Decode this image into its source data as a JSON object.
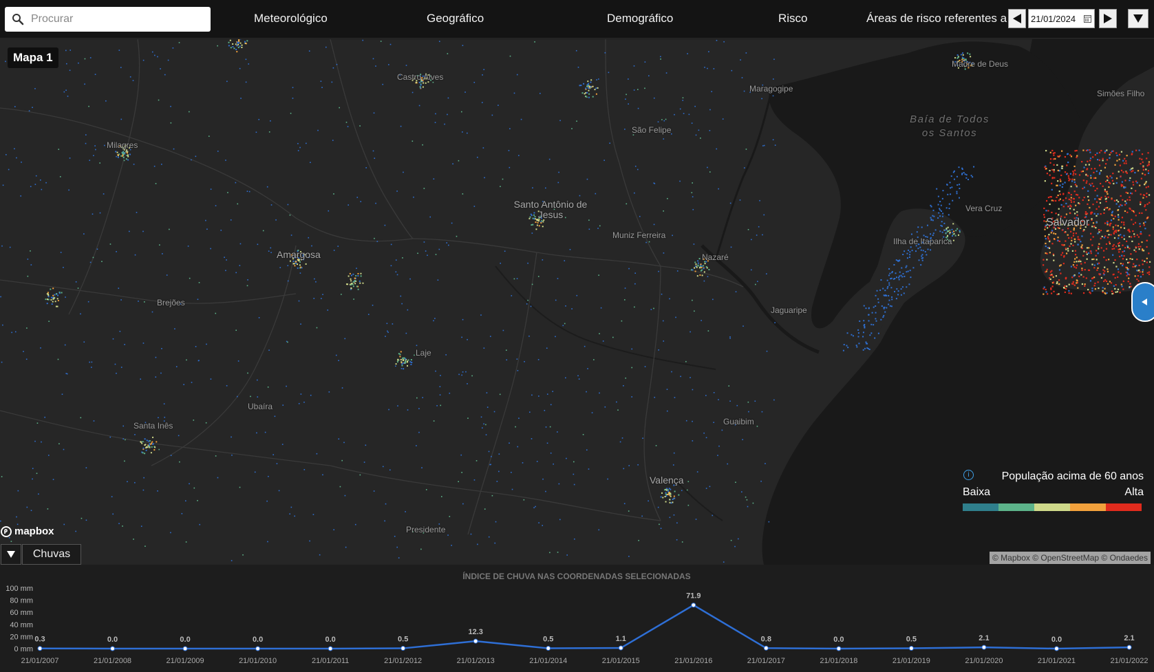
{
  "search": {
    "placeholder": "Procurar",
    "icon": "search-icon"
  },
  "nav": {
    "items": [
      {
        "label": "Meteorológico"
      },
      {
        "label": "Geográfico"
      },
      {
        "label": "Demográfico"
      },
      {
        "label": "Risco"
      }
    ],
    "risk_label": "Áreas de risco referentes a",
    "date_value": "21/01/2024"
  },
  "map": {
    "badge": "Mapa 1",
    "places": [
      "Castro Alves",
      "Madre de Deus",
      "Maragogipe",
      "Simões Filho",
      "Milagres",
      "São Felipe",
      "Santo Antônio de Jesus",
      "Vera Cruz",
      "Muniz Ferreira",
      "Amargosa",
      "Nazaré",
      "Ilha de Itaparica",
      "Salvador",
      "Brejões",
      "Jaguaripe",
      "Laje",
      "Ubaíra",
      "Santa Inês",
      "Guaibim",
      "Valença",
      "Presidente"
    ],
    "sea_label_lines": [
      "Baía de Todos",
      "os Santos"
    ],
    "mapbox_logo": "mapbox",
    "layer_name": "Chuvas",
    "legend": {
      "title": "População acima de 60 anos",
      "low": "Baixa",
      "high": "Alta",
      "colors": [
        "#2f7f8c",
        "#5db38a",
        "#cfd98a",
        "#f2a13c",
        "#e02b1d"
      ]
    },
    "attribution": "© Mapbox © OpenStreetMap © Ondaedes"
  },
  "chart_data": {
    "type": "line",
    "title": "ÍNDICE DE CHUVA NAS COORDENADAS SELECIONADAS",
    "x": [
      "21/01/2007",
      "21/01/2008",
      "21/01/2009",
      "21/01/2010",
      "21/01/2011",
      "21/01/2012",
      "21/01/2013",
      "21/01/2014",
      "21/01/2015",
      "21/01/2016",
      "21/01/2017",
      "21/01/2018",
      "21/01/2019",
      "21/01/2020",
      "21/01/2021",
      "21/01/2022"
    ],
    "values": [
      0.3,
      0.0,
      0.0,
      0.0,
      0.0,
      0.5,
      12.3,
      0.5,
      1.1,
      71.9,
      0.8,
      0.0,
      0.5,
      2.1,
      0.0,
      2.1
    ],
    "value_labels": [
      "0.3",
      "0.0",
      "0.0",
      "0.0",
      "0.0",
      "0.5",
      "12.3",
      "0.5",
      "1.1",
      "71.9",
      "0.8",
      "0.0",
      "0.5",
      "2.1",
      "0.0",
      "2.1"
    ],
    "y_ticks": [
      "0 mm",
      "20 mm",
      "40 mm",
      "60 mm",
      "80 mm",
      "100 mm"
    ],
    "ylim": [
      0,
      100
    ],
    "line_color": "#2e6fd6"
  }
}
